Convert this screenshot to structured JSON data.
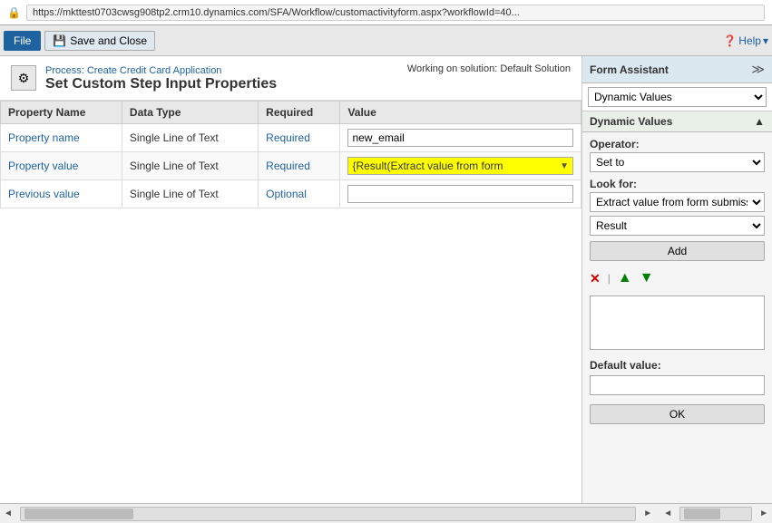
{
  "addressBar": {
    "url": "https://mkttest0703cwsg908tp2.crm10.dynamics.com/SFA/Workflow/customactivityform.aspx?workflowId=40...",
    "lockIcon": "🔒"
  },
  "toolbar": {
    "fileLabel": "File",
    "saveCloseLabel": "Save and Close",
    "helpLabel": "Help",
    "helpIcon": "❓"
  },
  "header": {
    "processLinkText": "Process: Create Credit Card Application",
    "pageTitle": "Set Custom Step Input Properties",
    "solutionText": "Working on solution: Default Solution",
    "iconText": "⚙"
  },
  "table": {
    "columns": [
      "Property Name",
      "Data Type",
      "Required",
      "Value"
    ],
    "rows": [
      {
        "propertyName": "Property name",
        "dataType": "Single Line of Text",
        "required": "Required",
        "valueText": "new_email",
        "isDynamic": false
      },
      {
        "propertyName": "Property value",
        "dataType": "Single Line of Text",
        "required": "Required",
        "valueText": "{Result(Extract value from form",
        "isDynamic": true
      },
      {
        "propertyName": "Previous value",
        "dataType": "Single Line of Text",
        "required": "Optional",
        "valueText": "",
        "isDynamic": false
      }
    ]
  },
  "formAssistant": {
    "title": "Form Assistant",
    "expandIcon": "≫",
    "dynamicValuesDropdown": "Dynamic Values",
    "dynamicValuesSectionTitle": "Dynamic Values",
    "collapseIcon": "▲",
    "operator": {
      "label": "Operator:",
      "value": "Set to"
    },
    "lookFor": {
      "label": "Look for:",
      "option1": "Extract value from form submission",
      "option2": "Result"
    },
    "addButton": "Add",
    "defaultValue": {
      "label": "Default value:",
      "value": ""
    },
    "okButton": "OK"
  }
}
